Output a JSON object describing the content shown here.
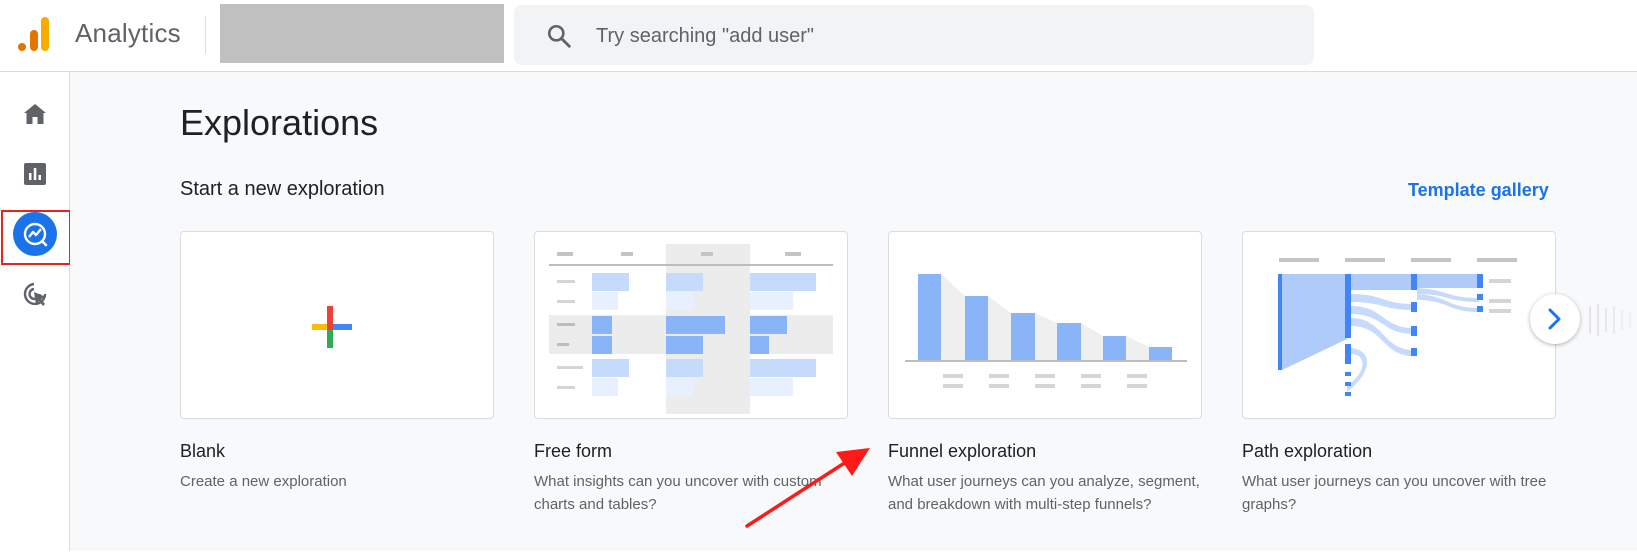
{
  "app": {
    "name": "Analytics"
  },
  "search": {
    "placeholder": "Try searching \"add user\""
  },
  "rail": {
    "items": [
      {
        "name": "home",
        "icon": "home-icon"
      },
      {
        "name": "reports",
        "icon": "bar-chart-icon"
      },
      {
        "name": "explore",
        "icon": "explore-icon",
        "selected": true
      },
      {
        "name": "advertising",
        "icon": "cursor-target-icon"
      }
    ]
  },
  "main": {
    "title": "Explorations",
    "section_title": "Start a new exploration",
    "template_link": "Template gallery",
    "cards": [
      {
        "title": "Blank",
        "desc": "Create a new exploration"
      },
      {
        "title": "Free form",
        "desc": "What insights can you uncover with custom charts and tables?"
      },
      {
        "title": "Funnel exploration",
        "desc": "What user journeys can you analyze, segment, and breakdown with multi-step funnels?"
      },
      {
        "title": "Path exploration",
        "desc": "What user journeys can you uncover with tree graphs?"
      }
    ]
  },
  "colors": {
    "accent": "#1a73e8",
    "thumb_light_blue": "#c6dafc",
    "thumb_blue": "#8ab4f8",
    "highlight_frame": "#e52620",
    "annotation_arrow": "#ff1a1a"
  }
}
